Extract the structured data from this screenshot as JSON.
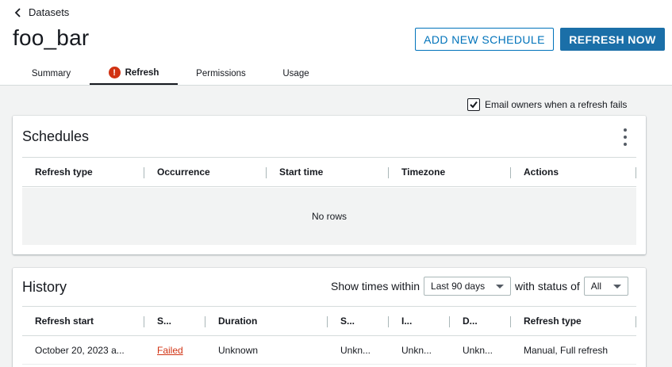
{
  "breadcrumb": {
    "label": "Datasets"
  },
  "page": {
    "title": "foo_bar"
  },
  "actions": {
    "add_schedule": "ADD NEW SCHEDULE",
    "refresh_now": "REFRESH NOW"
  },
  "tabs": [
    {
      "label": "Summary",
      "active": false
    },
    {
      "label": "Refresh",
      "active": true,
      "alert": "!"
    },
    {
      "label": "Permissions",
      "active": false
    },
    {
      "label": "Usage",
      "active": false
    }
  ],
  "email_option": {
    "label": "Email owners when a refresh fails",
    "checked": true
  },
  "schedules": {
    "title": "Schedules",
    "columns": [
      "Refresh type",
      "Occurrence",
      "Start time",
      "Timezone",
      "Actions"
    ],
    "empty_text": "No rows"
  },
  "history": {
    "title": "History",
    "show_times_label": "Show times within",
    "time_range": "Last 90 days",
    "status_label": "with status of",
    "status": "All",
    "columns": [
      "Refresh start",
      "S...",
      "Duration",
      "S...",
      "I...",
      "D...",
      "Refresh type"
    ],
    "rows": [
      {
        "refresh_start": "October 20, 2023 a...",
        "status": "Failed",
        "duration": "Unknown",
        "col4": "Unkn...",
        "col5": "Unkn...",
        "col6": "Unkn...",
        "refresh_type": "Manual, Full refresh"
      }
    ]
  },
  "colors": {
    "primary": "#1b6fa8",
    "link": "#0073bb",
    "error": "#d13212"
  }
}
